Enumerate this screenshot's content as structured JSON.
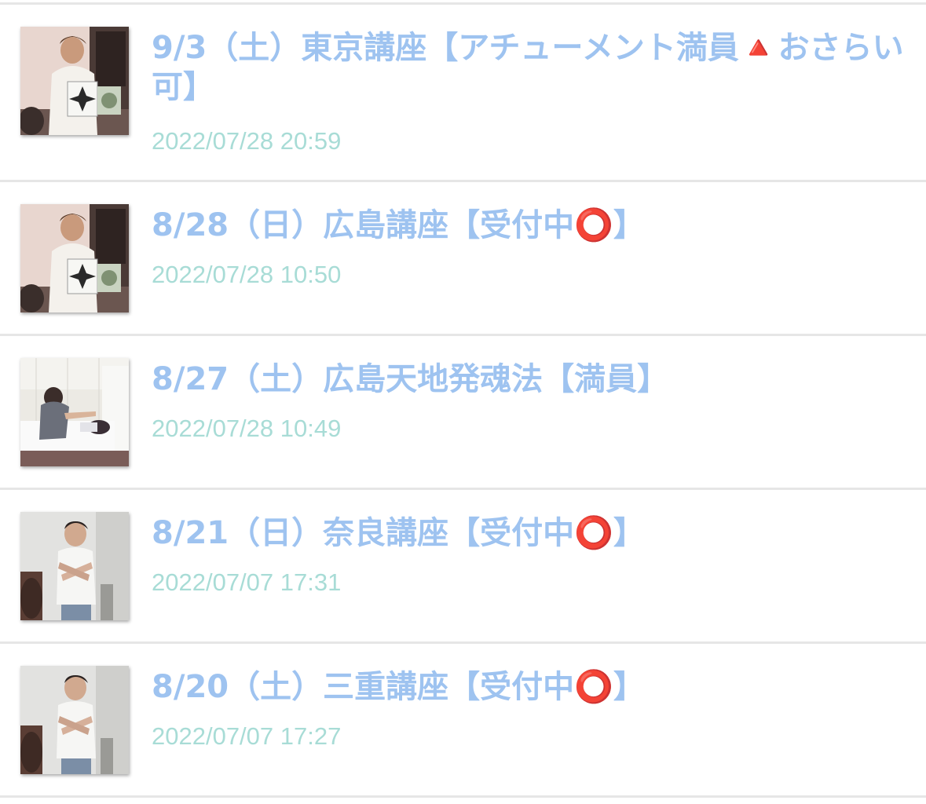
{
  "entries": [
    {
      "title": "9/3（土）東京講座【アチューメント満員🔺おさらい可】",
      "date": "2022/07/28 20:59",
      "thumbnail": "photo-man-white-jacket-holding-card"
    },
    {
      "title": "8/28（日）広島講座【受付中⭕️】",
      "date": "2022/07/28 10:50",
      "thumbnail": "photo-man-white-jacket-holding-card"
    },
    {
      "title": "8/27（土）広島天地発魂法【満員】",
      "date": "2022/07/28 10:49",
      "thumbnail": "photo-session-on-hotel-bed"
    },
    {
      "title": "8/21（日）奈良講座【受付中⭕️】",
      "date": "2022/07/07 17:31",
      "thumbnail": "photo-man-white-tshirt-arms-crossed"
    },
    {
      "title": "8/20（土）三重講座【受付中⭕️】",
      "date": "2022/07/07 17:27",
      "thumbnail": "photo-man-white-tshirt-arms-crossed"
    }
  ],
  "colors": {
    "title": "#9ec3f0",
    "date": "#a8dcd6",
    "divider": "#e6e6e6"
  }
}
